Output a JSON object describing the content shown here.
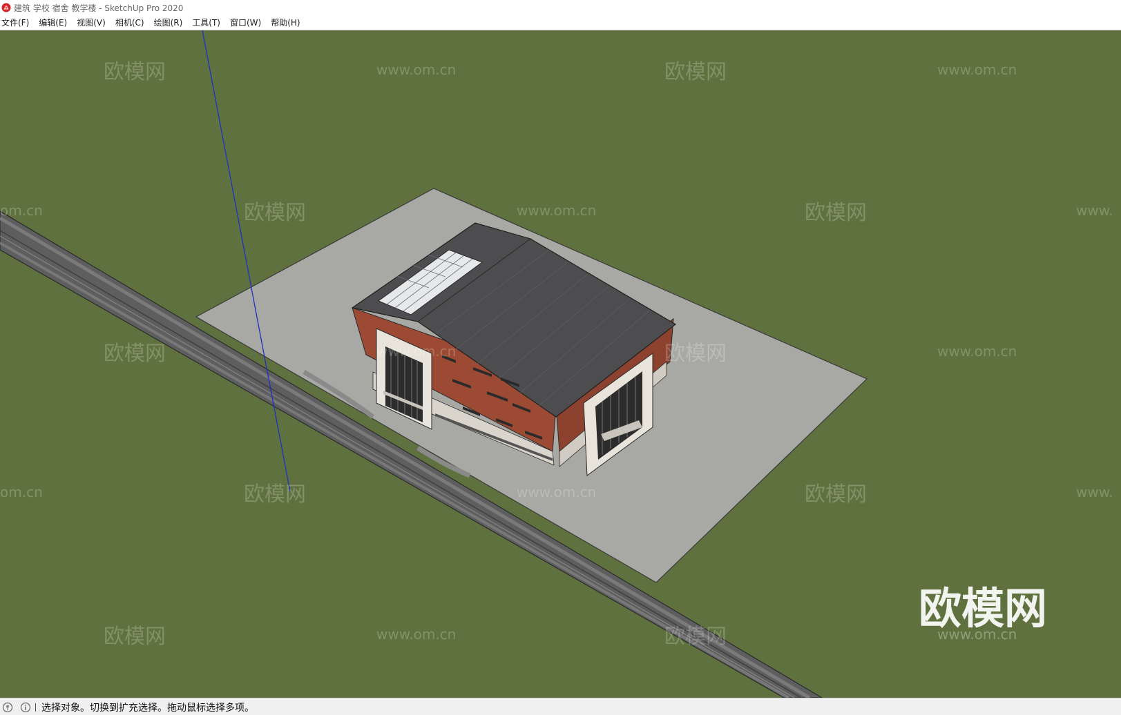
{
  "window": {
    "title": "建筑 学校 宿舍 教学楼 - SketchUp Pro 2020"
  },
  "menu": {
    "items": [
      "文件(F)",
      "编辑(E)",
      "视图(V)",
      "相机(C)",
      "绘图(R)",
      "工具(T)",
      "窗口(W)",
      "帮助(H)"
    ]
  },
  "watermarks": {
    "brand": "欧模网",
    "url": "www.om.cn",
    "url_partial_left": "om.cn",
    "url_partial_right": "www.",
    "big_logo": "欧模网",
    "big_url": "www.om.cn"
  },
  "status": {
    "text": "选择对象。切换到扩充选择。拖动鼠标选择多项。",
    "icons": [
      "geo-location-icon",
      "info-icon"
    ]
  },
  "colors": {
    "ground": "#5f713e",
    "site_pad": "#a8a8a4",
    "road": "#5e5e5e",
    "roof": "#4d4d4f",
    "brick": "#9c4a33",
    "axis_blue": "#2030c0"
  }
}
